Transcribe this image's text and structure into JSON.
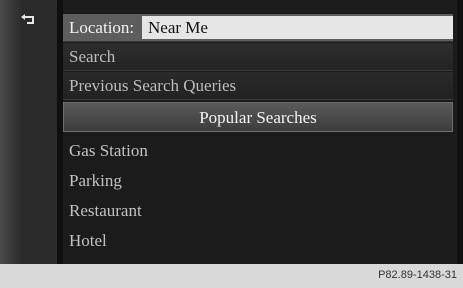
{
  "icons": {
    "back": "back-arrow-icon"
  },
  "location": {
    "label": "Location:",
    "value": "Near Me"
  },
  "menu": {
    "search": "Search",
    "previous": "Previous Search Queries",
    "popular_header": "Popular Searches",
    "popular_items": [
      "Gas Station",
      "Parking",
      "Restaurant",
      "Hotel"
    ]
  },
  "footer": {
    "code": "P82.89-1438-31"
  },
  "colors": {
    "highlight": "#5d5d5d",
    "value_bg": "#e6e6e6",
    "background": "#1b1b1b"
  }
}
